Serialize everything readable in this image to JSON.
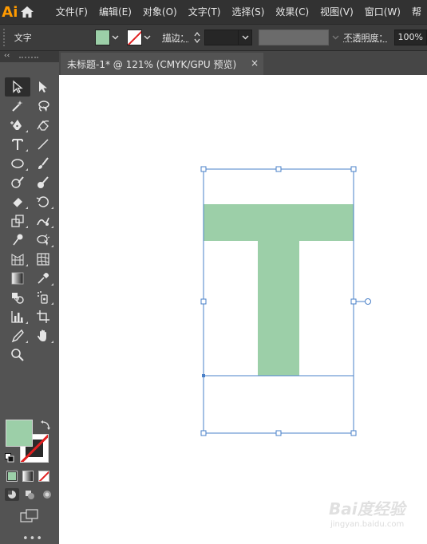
{
  "app": {
    "logo": "Ai"
  },
  "menubar": {
    "items": [
      "文件(F)",
      "编辑(E)",
      "对象(O)",
      "文字(T)",
      "选择(S)",
      "效果(C)",
      "视图(V)",
      "窗口(W)",
      "帮"
    ]
  },
  "controlbar": {
    "tool_label": "文字",
    "stroke_label": "描边：",
    "opacity_label": "不透明度：",
    "opacity_value": "100%"
  },
  "colors": {
    "fill": "#9ccfa8",
    "stroke_none_mark": "#e02020",
    "selection": "#4a80c8"
  },
  "document": {
    "tab_title": "未标题-1* @ 121% (CMYK/GPU 预览)",
    "close": "×",
    "glyph": "T"
  },
  "tools": {
    "collapse": "‹‹",
    "more": "•••",
    "icons": [
      [
        "selection-icon",
        "direct-selection-icon"
      ],
      [
        "magic-wand-icon",
        "lasso-icon"
      ],
      [
        "pen-icon",
        "curvature-icon"
      ],
      [
        "type-icon",
        "line-segment-icon"
      ],
      [
        "ellipse-icon",
        "paintbrush-icon"
      ],
      [
        "shaper-icon",
        "blob-brush-icon"
      ],
      [
        "eraser-icon",
        "rotate-icon"
      ],
      [
        "scale-icon",
        "warp-icon"
      ],
      [
        "puppet-warp-icon",
        "shape-builder-icon"
      ],
      [
        "perspective-grid-icon",
        "mesh-icon"
      ],
      [
        "gradient-icon",
        "eyedropper-icon"
      ],
      [
        "blend-icon",
        "symbol-sprayer-icon"
      ],
      [
        "column-graph-icon",
        "artboard-icon"
      ],
      [
        "slice-icon",
        "hand-icon"
      ],
      [
        "zoom-icon",
        ""
      ]
    ]
  },
  "watermark": {
    "logo": "Bai度经验",
    "url": "jingyan.baidu.com"
  }
}
